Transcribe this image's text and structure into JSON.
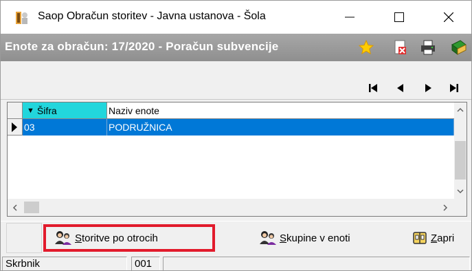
{
  "window": {
    "title": "Saop Obračun storitev - Javna ustanova - Šola",
    "min_glyph": "—",
    "max_glyph": "☐",
    "close_glyph": "✕"
  },
  "caption": {
    "text": "Enote za obračun: 17/2020 - Poračun subvencije",
    "icons": [
      "star-icon",
      "delete-document-icon",
      "printer-icon",
      "book-icon"
    ]
  },
  "navigator": {
    "buttons": [
      "first-record-icon",
      "prior-record-icon",
      "next-record-icon",
      "last-record-icon"
    ]
  },
  "grid": {
    "columns": [
      {
        "label": "Šifra",
        "sort": "▼"
      },
      {
        "label": "Naziv enote"
      }
    ],
    "rows": [
      {
        "sifra": "03",
        "naziv": "PODRUŽNICA",
        "selected": true
      }
    ],
    "current_row_marker": "▶"
  },
  "buttons": {
    "storitve": {
      "pre": "",
      "underline": "S",
      "post": "toritve po otrocih"
    },
    "skupine": {
      "pre": "",
      "underline": "S",
      "post": "kupine v enoti"
    },
    "zapri": {
      "pre": "",
      "underline": "Z",
      "post": "apri"
    }
  },
  "status": {
    "panel1": "Skrbnik",
    "panel2": "001",
    "panel3": ""
  },
  "colors": {
    "selection": "#0078d7",
    "sorted_header": "#22d6dc",
    "highlight_border": "#e21b2c"
  }
}
